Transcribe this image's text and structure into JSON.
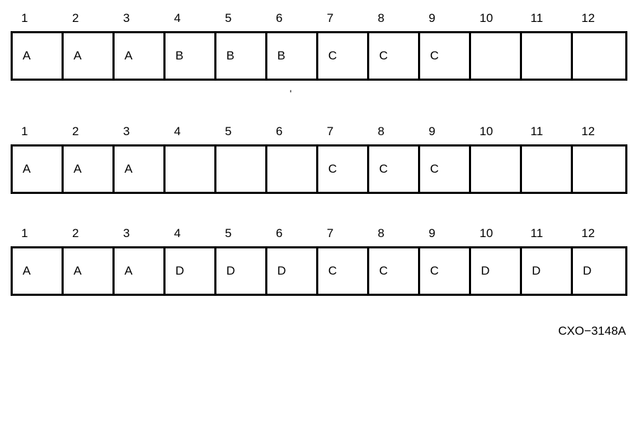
{
  "tables": [
    {
      "headers": [
        "1",
        "2",
        "3",
        "4",
        "5",
        "6",
        "7",
        "8",
        "9",
        "10",
        "11",
        "12"
      ],
      "cells": [
        "A",
        "A",
        "A",
        "B",
        "B",
        "B",
        "C",
        "C",
        "C",
        "",
        "",
        ""
      ]
    },
    {
      "headers": [
        "1",
        "2",
        "3",
        "4",
        "5",
        "6",
        "7",
        "8",
        "9",
        "10",
        "11",
        "12"
      ],
      "cells": [
        "A",
        "A",
        "A",
        "",
        "",
        "",
        "C",
        "C",
        "C",
        "",
        "",
        ""
      ]
    },
    {
      "headers": [
        "1",
        "2",
        "3",
        "4",
        "5",
        "6",
        "7",
        "8",
        "9",
        "10",
        "11",
        "12"
      ],
      "cells": [
        "A",
        "A",
        "A",
        "D",
        "D",
        "D",
        "C",
        "C",
        "C",
        "D",
        "D",
        "D"
      ]
    }
  ],
  "gap_marker": "'",
  "figure_code": "CXO−3148A"
}
